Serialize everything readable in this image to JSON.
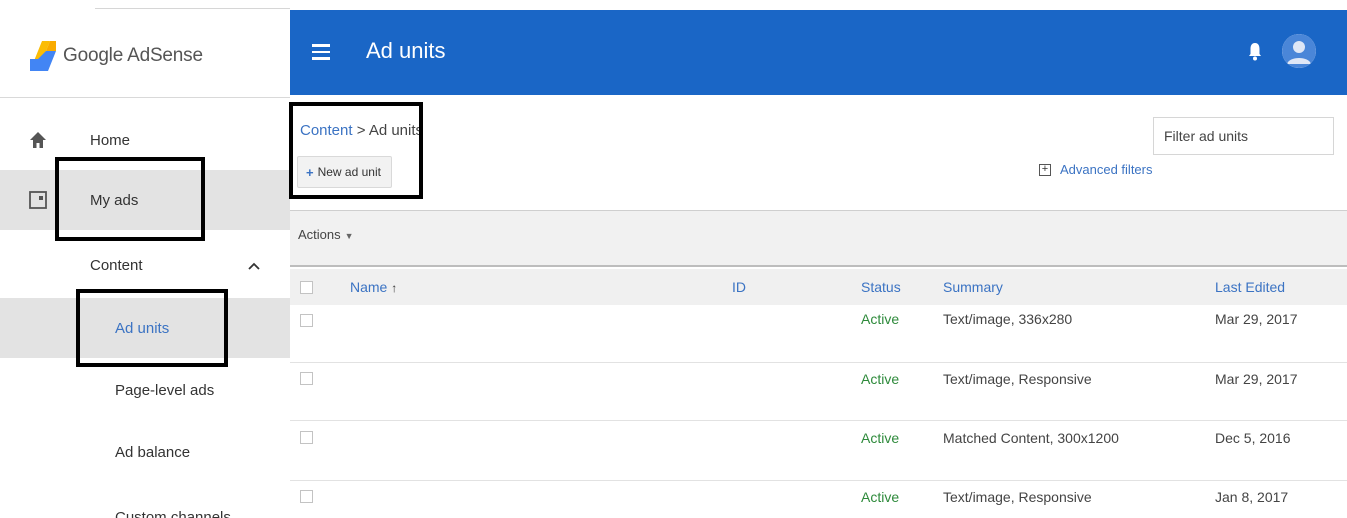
{
  "brand": {
    "name": "Google AdSense"
  },
  "sidebar": {
    "items": [
      {
        "label": "Home"
      },
      {
        "label": "My ads"
      },
      {
        "label": "Content"
      },
      {
        "label": "Ad units"
      },
      {
        "label": "Page-level ads"
      },
      {
        "label": "Ad balance"
      },
      {
        "label": "Custom channels"
      }
    ]
  },
  "topbar": {
    "title": "Ad units"
  },
  "breadcrumb": {
    "link": "Content",
    "separator": ">",
    "current": "Ad units"
  },
  "toolbar": {
    "new_label": "New ad unit",
    "actions_label": "Actions"
  },
  "filter": {
    "placeholder": "Filter ad units",
    "advanced_label": "Advanced filters"
  },
  "table": {
    "headers": {
      "name": "Name",
      "id": "ID",
      "status": "Status",
      "summary": "Summary",
      "last_edited": "Last Edited"
    },
    "rows": [
      {
        "name": "",
        "id": "",
        "status": "Active",
        "summary": "Text/image, 336x280",
        "last_edited": "Mar 29, 2017"
      },
      {
        "name": "",
        "id": "",
        "status": "Active",
        "summary": "Text/image, Responsive",
        "last_edited": "Mar 29, 2017"
      },
      {
        "name": "",
        "id": "",
        "status": "Active",
        "summary": "Matched Content, 300x1200",
        "last_edited": "Dec 5, 2016"
      },
      {
        "name": "",
        "id": "",
        "status": "Active",
        "summary": "Text/image, Responsive",
        "last_edited": "Jan 8, 2017"
      }
    ]
  },
  "colors": {
    "topbar": "#1a66c6",
    "link": "#3b73c3",
    "status_active": "#2e8a3b",
    "selected_bg": "#e3e3e3"
  },
  "icons": [
    "adsense-logo-icon",
    "home-icon",
    "my-ads-icon",
    "chevron-up-icon",
    "menu-icon",
    "bell-icon",
    "avatar-icon",
    "plus-icon",
    "advanced-filters-icon",
    "caret-down-icon",
    "sort-up-icon"
  ]
}
